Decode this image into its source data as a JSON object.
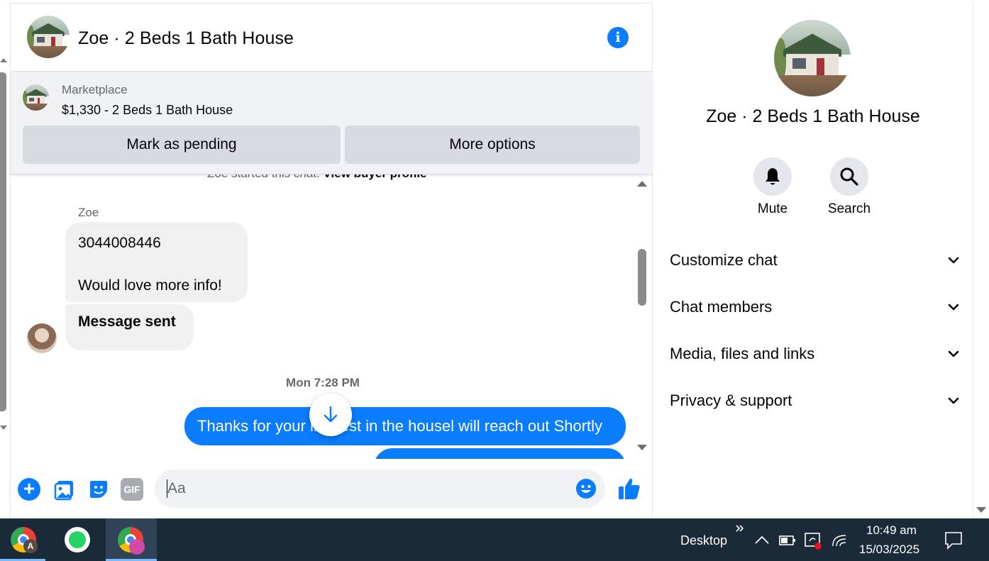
{
  "chat": {
    "title": "Zoe · 2 Beds 1 Bath House",
    "marketplace": {
      "label": "Marketplace",
      "listing": "$1,330 - 2 Beds 1 Bath House",
      "pending_button": "Mark as pending",
      "more_button": "More options"
    },
    "started_text_prefix": "Zoe started this chat.",
    "view_profile_link": "View buyer profile",
    "messages": [
      {
        "sender": "Zoe",
        "line1": "3044008446",
        "line2": "Would love more info!"
      },
      {
        "text": "Message sent"
      }
    ],
    "timestamp": "Mon 7:28 PM",
    "outgoing": [
      {
        "text": "Thanks for your interest in the housel will reach out Shortly"
      }
    ],
    "composer": {
      "placeholder": "Aa",
      "gif_label": "GIF"
    }
  },
  "info_panel": {
    "name": "Zoe · 2 Beds 1 Bath House",
    "actions": {
      "mute": "Mute",
      "search": "Search"
    },
    "sections": [
      "Customize chat",
      "Chat members",
      "Media, files and links",
      "Privacy & support"
    ]
  },
  "taskbar": {
    "desktop_label": "Desktop",
    "time": "10:49 am",
    "date": "15/03/2025",
    "chrome_badge": "A"
  },
  "colors": {
    "accent": "#0a7cff",
    "taskbar": "#1b2a38"
  },
  "icons": [
    "info-icon",
    "bell-icon",
    "search-icon",
    "chevron-down-icon",
    "plus-icon",
    "photo-icon",
    "sticker-icon",
    "gif-icon",
    "emoji-icon",
    "like-icon",
    "arrow-down-icon"
  ]
}
